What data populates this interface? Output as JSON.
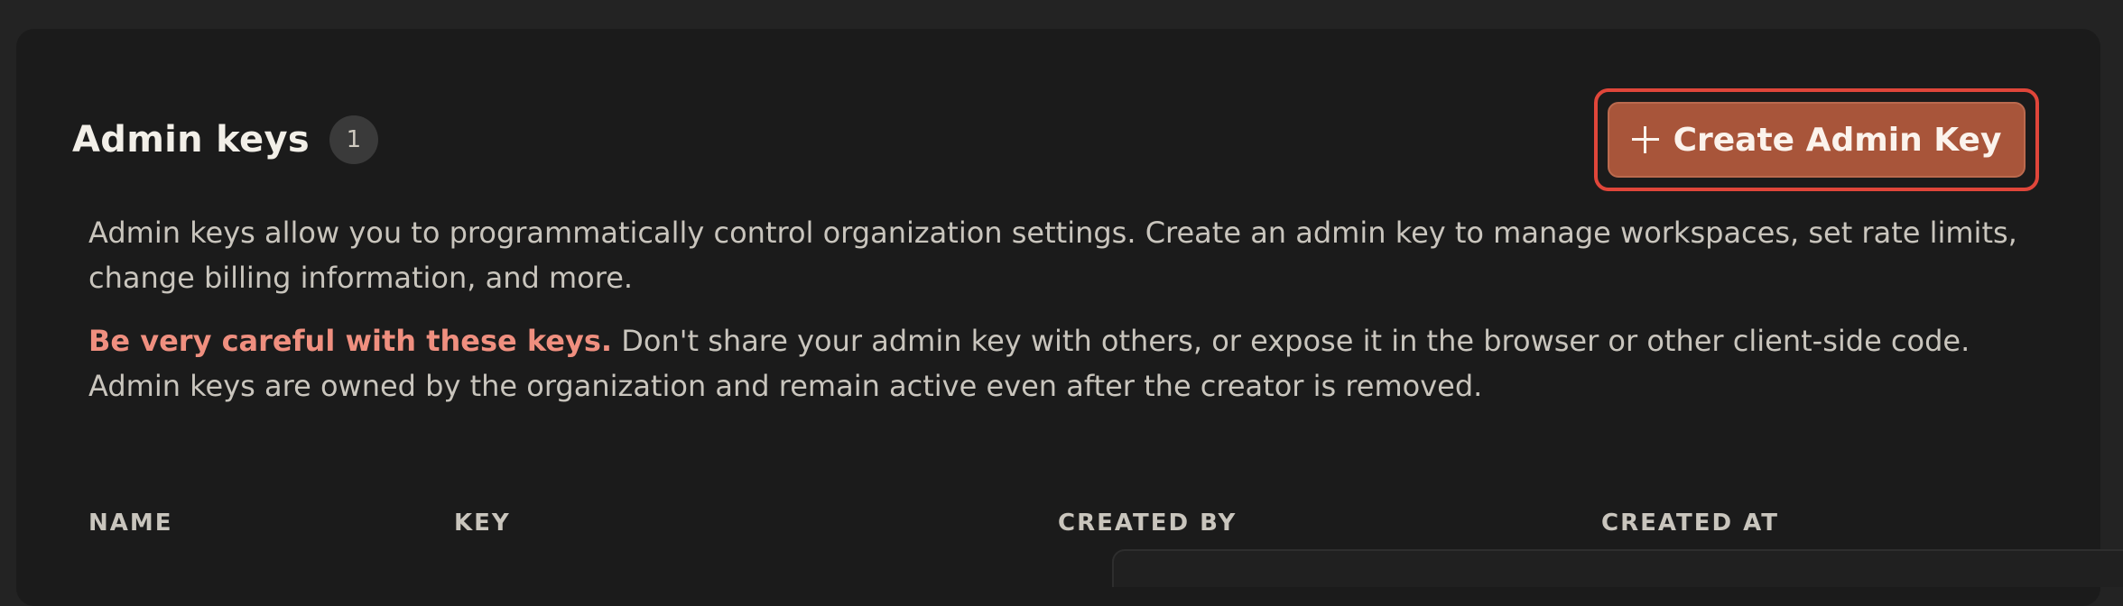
{
  "section": {
    "title": "Admin keys",
    "count": "1",
    "create_button_label": "Create Admin Key",
    "description": "Admin keys allow you to programmatically control organization settings. Create an admin key to manage workspaces, set rate limits, change billing information, and more.",
    "warning_emphasis": "Be very careful with these keys.",
    "warning_text": " Don't share your admin key with others, or expose it in the browser or other client-side code. Admin keys are owned by the organization and remain active even after the creator is removed."
  },
  "table": {
    "columns": [
      "NAME",
      "KEY",
      "CREATED BY",
      "CREATED AT"
    ]
  },
  "colors": {
    "accent": "#a8553a",
    "warning": "#ef8f7f",
    "highlight_outline": "#e0463a"
  },
  "icons": {
    "create": "plus-icon"
  }
}
